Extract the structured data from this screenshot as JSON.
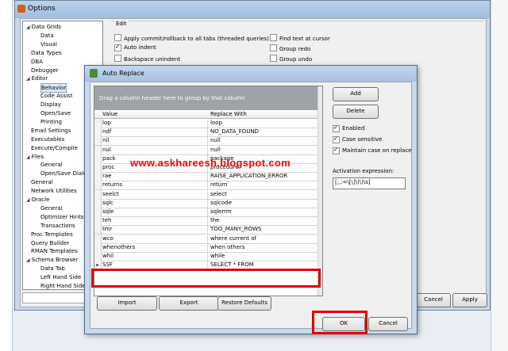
{
  "options_window": {
    "title": "Options",
    "tree": [
      {
        "label": "Data Grids",
        "indent": 0,
        "expander": true
      },
      {
        "label": "Data",
        "indent": 1
      },
      {
        "label": "Visual",
        "indent": 1
      },
      {
        "label": "Data Types",
        "indent": 0
      },
      {
        "label": "DBA",
        "indent": 0
      },
      {
        "label": "Debugger",
        "indent": 0
      },
      {
        "label": "Editor",
        "indent": 0,
        "expander": true
      },
      {
        "label": "Behavior",
        "indent": 1,
        "selected": true
      },
      {
        "label": "Code Assist",
        "indent": 1
      },
      {
        "label": "Display",
        "indent": 1
      },
      {
        "label": "Open/Save",
        "indent": 1
      },
      {
        "label": "Printing",
        "indent": 1
      },
      {
        "label": "Email Settings",
        "indent": 0
      },
      {
        "label": "Executables",
        "indent": 0
      },
      {
        "label": "Execute/Compile",
        "indent": 0
      },
      {
        "label": "Files",
        "indent": 0,
        "expander": true
      },
      {
        "label": "General",
        "indent": 1
      },
      {
        "label": "Open/Save Dialog",
        "indent": 1
      },
      {
        "label": "General",
        "indent": 0
      },
      {
        "label": "Network Utilities",
        "indent": 0
      },
      {
        "label": "Oracle",
        "indent": 0,
        "expander": true
      },
      {
        "label": "General",
        "indent": 1
      },
      {
        "label": "Optimizer Hints",
        "indent": 1
      },
      {
        "label": "Transactions",
        "indent": 1
      },
      {
        "label": "Proc Templates",
        "indent": 0
      },
      {
        "label": "Query Builder",
        "indent": 0
      },
      {
        "label": "RMAN Templates",
        "indent": 0
      },
      {
        "label": "Schema Browser",
        "indent": 0,
        "expander": true
      },
      {
        "label": "Data Tab",
        "indent": 1
      },
      {
        "label": "Left Hand Side",
        "indent": 1
      },
      {
        "label": "Right Hand Side",
        "indent": 1
      }
    ],
    "edit_group_title": "Edit",
    "checkboxes_left": [
      {
        "label": "Apply commit/rollback to all tabs (threaded queries)",
        "checked": false
      },
      {
        "label": "Auto indent",
        "checked": true
      },
      {
        "label": "Backspace unindent",
        "checked": false
      }
    ],
    "checkboxes_right": [
      {
        "label": "Find text at cursor",
        "checked": false
      },
      {
        "label": "Group redo",
        "checked": false
      },
      {
        "label": "Group undo",
        "checked": false
      }
    ],
    "cancel_label": "Cancel",
    "apply_label": "Apply"
  },
  "dialog": {
    "title": "Auto Replace",
    "group_header_text": "Drag a column header here to group by that column",
    "columns": [
      "Value",
      "Replace With"
    ],
    "rows": [
      {
        "value": "lop",
        "replace": "loop"
      },
      {
        "value": "ndf",
        "replace": "NO_DATA_FOUND"
      },
      {
        "value": "nil",
        "replace": "null"
      },
      {
        "value": "nul",
        "replace": "null"
      },
      {
        "value": "pack",
        "replace": "package"
      },
      {
        "value": "proc",
        "replace": "procedure"
      },
      {
        "value": "rae",
        "replace": "RAISE_APPLICATION_ERROR"
      },
      {
        "value": "returns",
        "replace": "return"
      },
      {
        "value": "seelct",
        "replace": "select"
      },
      {
        "value": "sqlc",
        "replace": "sqlcode"
      },
      {
        "value": "sqle",
        "replace": "sqlerrm"
      },
      {
        "value": "teh",
        "replace": "the"
      },
      {
        "value": "tmr",
        "replace": "TOO_MANY_ROWS"
      },
      {
        "value": "wco",
        "replace": "where current of"
      },
      {
        "value": "whenothers",
        "replace": "when others"
      },
      {
        "value": "whil",
        "replace": "while"
      },
      {
        "value": "SSF",
        "replace": "SELECT * FROM",
        "current": true
      }
    ],
    "add_label": "Add",
    "delete_label": "Delete",
    "enabled_label": "Enabled",
    "case_sensitive_label": "Case sensitive",
    "maintain_case_label": "Maintain case on replace",
    "activation_label": "Activation expression:",
    "activation_value": "[;,:=\\[\\]\\(\\)\\s]",
    "import_label": "Import",
    "export_label": "Export",
    "restore_label": "Restore Defaults",
    "ok_label": "OK",
    "cancel_label": "Cancel"
  },
  "watermark": "www.askhareesh.blogspot.com",
  "colors": {
    "highlight": "#e00000",
    "watermark": "#ff0000"
  }
}
